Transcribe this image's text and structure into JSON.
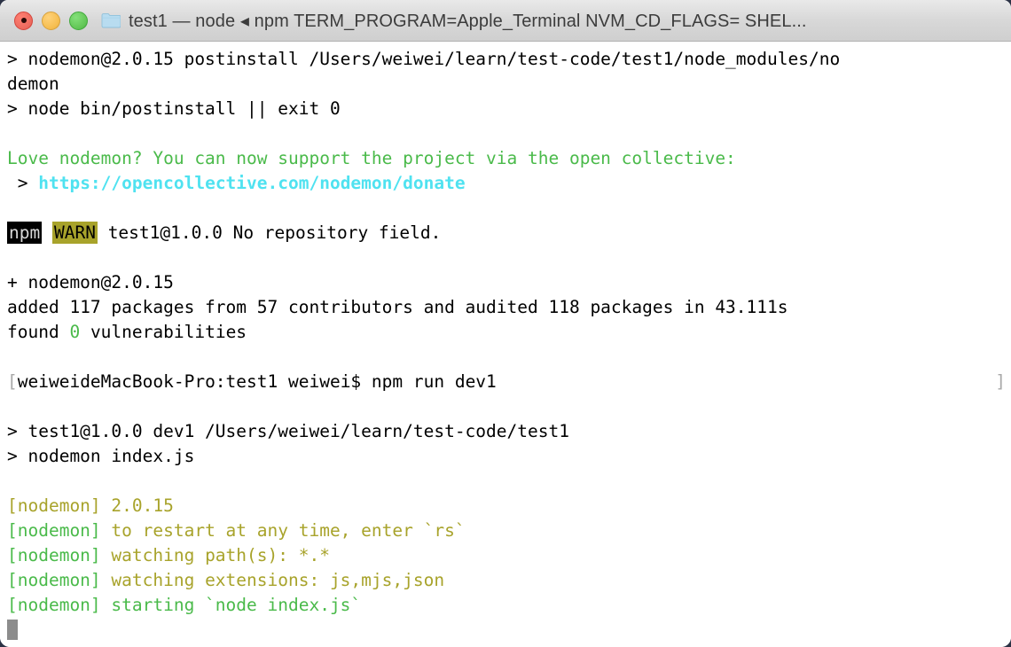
{
  "window": {
    "title": "test1 — node ◂ npm TERM_PROGRAM=Apple_Terminal NVM_CD_FLAGS= SHEL...",
    "folder_icon": "folder-icon",
    "traffic_lights": {
      "close_label": "close",
      "minimize_label": "minimize",
      "maximize_label": "maximize"
    }
  },
  "colors": {
    "green": "#4aba4a",
    "olive": "#a8a32b",
    "cyan": "#4fe2f0",
    "cursor": "#8c8c8c",
    "background": "#ffffff",
    "foreground": "#000000",
    "titlebar": "#d8d8d8"
  },
  "terminal": {
    "lines": [
      {
        "id": "l01",
        "text": "> nodemon@2.0.15 postinstall /Users/weiwei/learn/test-code/test1/node_modules/no"
      },
      {
        "id": "l02",
        "text": "demon"
      },
      {
        "id": "l03",
        "text": "> node bin/postinstall || exit 0"
      },
      {
        "id": "l04",
        "text": ""
      },
      {
        "id": "l05",
        "text": "Love nodemon? You can now support the project via the open collective:"
      },
      {
        "id": "l06a",
        "text": " > "
      },
      {
        "id": "l06b",
        "text": "https://opencollective.com/nodemon/donate"
      },
      {
        "id": "l07",
        "text": ""
      },
      {
        "id": "l08a",
        "text": "npm"
      },
      {
        "id": "l08b",
        "text": "WARN"
      },
      {
        "id": "l08c",
        "text": " test1@1.0.0 No repository field."
      },
      {
        "id": "l09",
        "text": ""
      },
      {
        "id": "l10",
        "text": "+ nodemon@2.0.15"
      },
      {
        "id": "l11",
        "text": "added 117 packages from 57 contributors and audited 118 packages in 43.111s"
      },
      {
        "id": "l12a",
        "text": "found "
      },
      {
        "id": "l12b",
        "text": "0"
      },
      {
        "id": "l12c",
        "text": " vulnerabilities"
      },
      {
        "id": "l13",
        "text": ""
      },
      {
        "id": "l14mark",
        "text": "["
      },
      {
        "id": "l14",
        "text": "weiweideMacBook-Pro:test1 weiwei$ npm run dev1"
      },
      {
        "id": "l14end",
        "text": "]"
      },
      {
        "id": "l15",
        "text": ""
      },
      {
        "id": "l16",
        "text": "> test1@1.0.0 dev1 /Users/weiwei/learn/test-code/test1"
      },
      {
        "id": "l17",
        "text": "> nodemon index.js"
      },
      {
        "id": "l18",
        "text": ""
      },
      {
        "id": "l19a",
        "text": "[nodemon] "
      },
      {
        "id": "l19b",
        "text": "2.0.15"
      },
      {
        "id": "l20a",
        "text": "[nodemon] "
      },
      {
        "id": "l20b",
        "text": "to restart at any time, enter `rs`"
      },
      {
        "id": "l21a",
        "text": "[nodemon] "
      },
      {
        "id": "l21b",
        "text": "watching path(s): *.*"
      },
      {
        "id": "l22a",
        "text": "[nodemon] "
      },
      {
        "id": "l22b",
        "text": "watching extensions: js,mjs,json"
      },
      {
        "id": "l23",
        "text": "[nodemon] starting `node index.js`"
      }
    ]
  }
}
